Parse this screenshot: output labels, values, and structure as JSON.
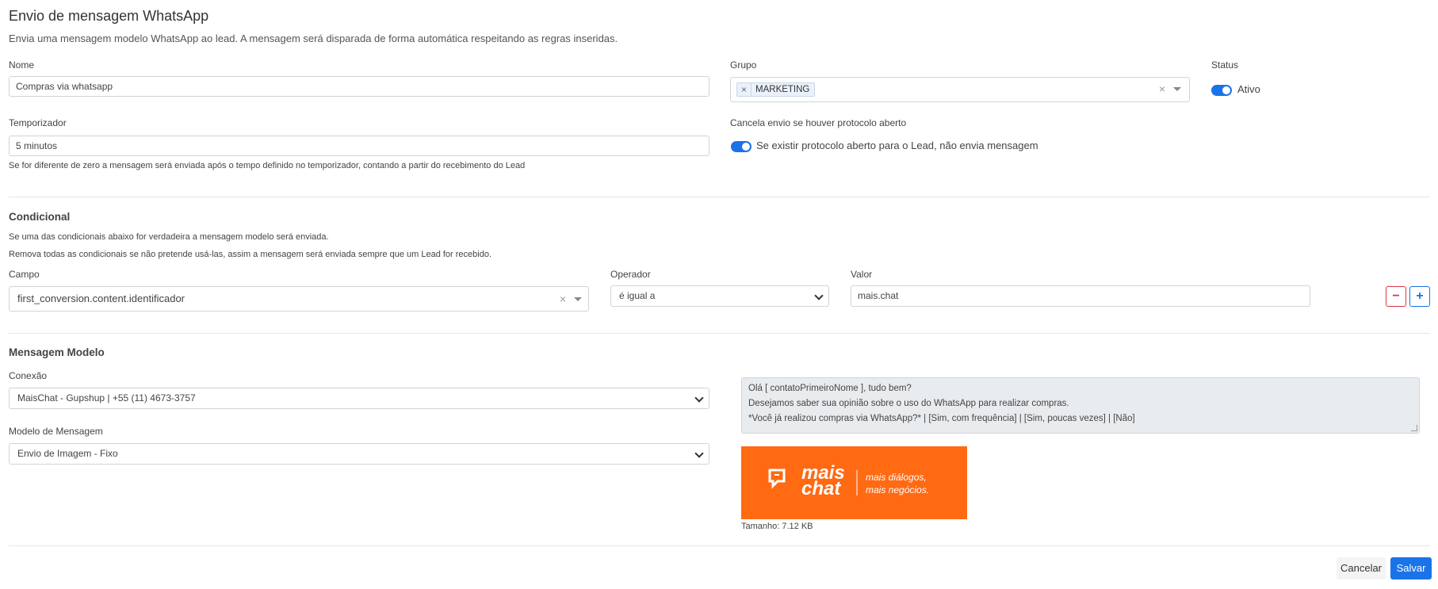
{
  "header": {
    "title": "Envio de mensagem WhatsApp",
    "subtitle": "Envia uma mensagem modelo WhatsApp ao lead. A mensagem será disparada de forma automática respeitando as regras inseridas."
  },
  "form": {
    "nome_label": "Nome",
    "nome_value": "Compras via whatsapp",
    "grupo_label": "Grupo",
    "grupo_tag": "MARKETING",
    "status_label": "Status",
    "status_toggle_label": "Ativo",
    "temporizador_label": "Temporizador",
    "temporizador_value": "5 minutos",
    "temporizador_help": "Se for diferente de zero a mensagem será enviada após o tempo definido no temporizador, contando a partir do recebimento do Lead",
    "cancela_label": "Cancela envio se houver protocolo aberto",
    "cancela_toggle_label": "Se existir protocolo aberto para o Lead, não envia mensagem"
  },
  "condicional": {
    "title": "Condicional",
    "help1": "Se uma das condicionais abaixo for verdadeira a mensagem modelo será enviada.",
    "help2": "Remova todas as condicionais se não pretende usá-las, assim a mensagem será enviada sempre que um Lead for recebido.",
    "campo_label": "Campo",
    "campo_value": "first_conversion.content.identificador",
    "operador_label": "Operador",
    "operador_value": "é igual a",
    "valor_label": "Valor",
    "valor_value": "mais.chat",
    "remove_symbol": "−",
    "add_symbol": "+"
  },
  "mensagem": {
    "title": "Mensagem Modelo",
    "conexao_label": "Conexão",
    "conexao_value": "MaisChat - Gupshup | +55 (11) 4673-3757",
    "modelo_label": "Modelo de Mensagem",
    "modelo_value": "Envio de Imagem - Fixo",
    "preview_line1": "Olá [ contatoPrimeiroNome ], tudo bem?",
    "preview_line2": "Desejamos saber sua opinião sobre o uso do WhatsApp para realizar compras.",
    "preview_line3": "*Você já realizou compras via WhatsApp?* | [Sim, com frequência] | [Sim, poucas vezes] | [Não]",
    "image_brand_line1": "mais",
    "image_brand_line2": "chat",
    "image_tagline1": "mais diálogos,",
    "image_tagline2": "mais negócios.",
    "size_label": "Tamanho:",
    "size_value": "7.12 KB"
  },
  "footer": {
    "cancel_label": "Cancelar",
    "save_label": "Salvar"
  },
  "colors": {
    "accent": "#1a73e8",
    "danger": "#dc3545",
    "banner": "#ff6a13"
  }
}
